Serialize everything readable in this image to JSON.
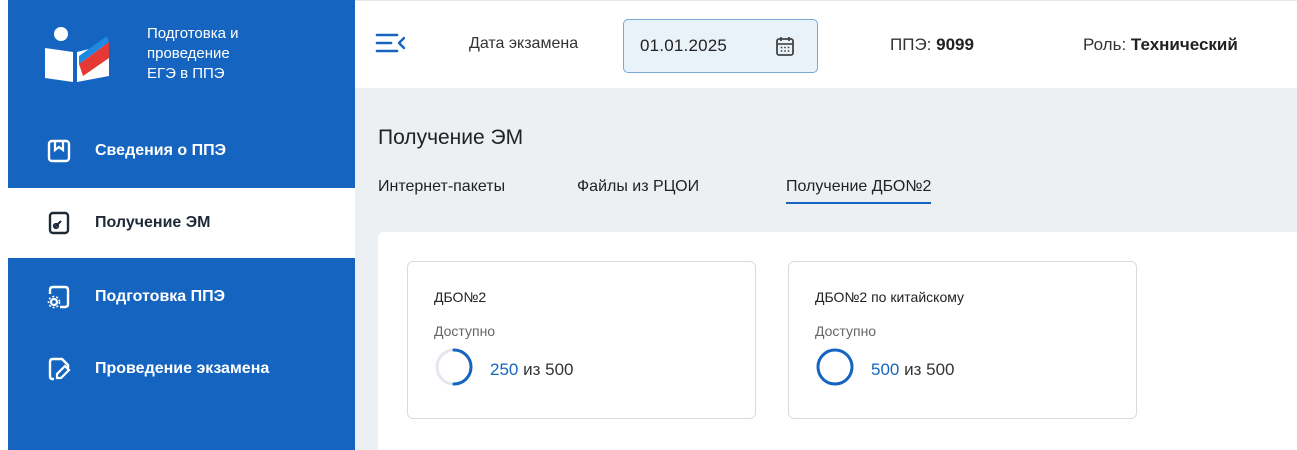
{
  "logo": {
    "lines": [
      "Подготовка и",
      "проведение",
      "ЕГЭ в ППЭ"
    ]
  },
  "sidebar": {
    "items": [
      {
        "label": "Сведения о ППЭ",
        "icon": "bookmark-icon",
        "active": false
      },
      {
        "label": "Получение ЭМ",
        "icon": "download-doc-icon",
        "active": true
      },
      {
        "label": "Подготовка ППЭ",
        "icon": "gear-doc-icon",
        "active": false
      },
      {
        "label": "Проведение экзамена",
        "icon": "pen-doc-icon",
        "active": false
      }
    ]
  },
  "topbar": {
    "date_label": "Дата экзамена",
    "date_value": "01.01.2025",
    "ppe_label": "ППЭ:",
    "ppe_value": "9099",
    "role_label": "Роль:",
    "role_value": "Технический"
  },
  "main": {
    "title": "Получение ЭМ",
    "tabs": [
      {
        "label": "Интернет-пакеты",
        "active": false
      },
      {
        "label": "Файлы из РЦОИ",
        "active": false
      },
      {
        "label": "Получение ДБО№2",
        "active": true
      }
    ],
    "cards": [
      {
        "title": "ДБО№2",
        "status": "Доступно",
        "current": "250",
        "sep": "из",
        "total": "500",
        "progress": 0.5
      },
      {
        "title": "ДБО№2 по китайскому",
        "status": "Доступно",
        "current": "500",
        "sep": "из",
        "total": "500",
        "progress": 1.0
      }
    ]
  },
  "colors": {
    "brand": "#1565c0",
    "background": "#edf0f3",
    "date_field_bg": "#e9f1f9"
  }
}
